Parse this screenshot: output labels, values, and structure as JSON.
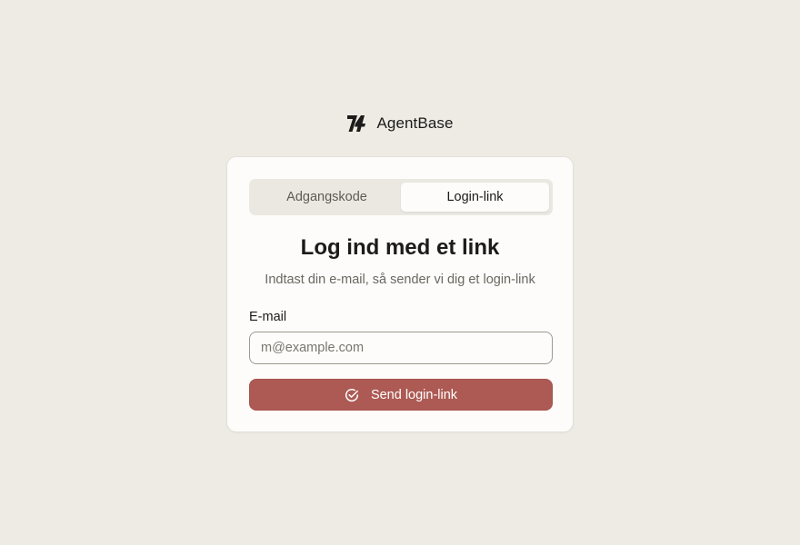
{
  "brand": {
    "name": "AgentBase",
    "logo_icon": "agentbase-logo-icon"
  },
  "tabs": [
    {
      "label": "Adgangskode",
      "active": false
    },
    {
      "label": "Login-link",
      "active": true
    }
  ],
  "form": {
    "title": "Log ind med et link",
    "subtitle": "Indtast din e-mail, så sender vi dig et login-link",
    "email_label": "E-mail",
    "email_value": "",
    "email_placeholder": "m@example.com",
    "submit_label": "Send login-link",
    "submit_icon": "check-circle-icon"
  },
  "colors": {
    "background": "#eeebe5",
    "card": "#fdfcfa",
    "accent": "#ad5a54",
    "text": "#1c1b19",
    "muted_text": "#6b6761"
  }
}
